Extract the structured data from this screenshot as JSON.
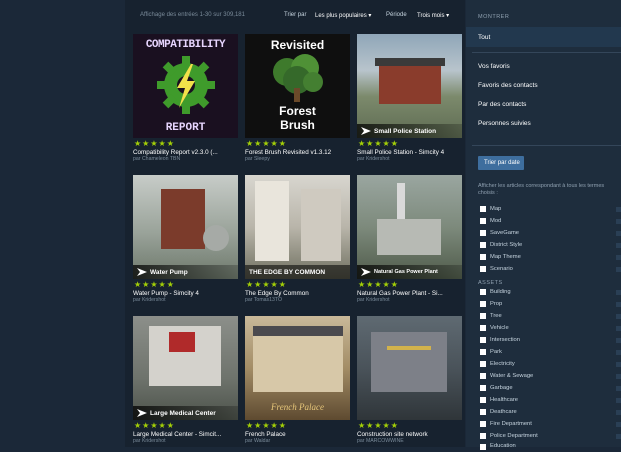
{
  "toolbar": {
    "count_text": "Affichage des entrées 1-30 sur 309,181",
    "sort_label": "Trier par",
    "sort_value": "Les plus populaires ▾",
    "period_label": "Période",
    "period_value": "Trois mois ▾"
  },
  "items": [
    {
      "title": "Compatibility Report v2.3.0 (...",
      "author": "par Chameleon TBN",
      "stars": "★★★★★",
      "thumb_text_top": "COMPATIBILITY",
      "thumb_text_bottom": "REPORT"
    },
    {
      "title": "Forest Brush Revisited v1.3.12",
      "author": "par Sleepy",
      "stars": "★★★★★",
      "thumb_text_top": "Revisited",
      "thumb_text_mid": "Forest",
      "thumb_text_bottom": "Brush"
    },
    {
      "title": "Small Police Station - Simcity 4",
      "author": "par Kridershot",
      "stars": "★★★★★",
      "badge": "Small Police Station"
    },
    {
      "title": "Water Pump - Simcity 4",
      "author": "par Kridershot",
      "stars": "★★★★★",
      "badge": "Water Pump"
    },
    {
      "title": "The Edge By Common",
      "author": "par Tomas13TO",
      "stars": "★★★★★",
      "badge": "THE EDGE BY COMMON"
    },
    {
      "title": "Natural Gas Power Plant - Si...",
      "author": "par Kridershot",
      "stars": "★★★★★",
      "badge": "Natural Gas Power Plant"
    },
    {
      "title": "Large Medical Center - Simcit...",
      "author": "par Kridershot",
      "stars": "★★★★★",
      "badge": "Large Medical Center"
    },
    {
      "title": "French Palace",
      "author": "par Waldar",
      "stars": "★★★★★",
      "badge": "French Palace"
    },
    {
      "title": "Construction site network",
      "author": "par MARCOWWINE",
      "stars": "★★★★★"
    }
  ],
  "sidebar": {
    "show_header": "MONTRER",
    "nav": [
      "Tout",
      "Vos favoris",
      "Favoris des contacts",
      "Par des contacts",
      "Personnes suivies"
    ],
    "sort_button": "Trier par date",
    "hint": "Afficher les articles correspondant à tous les termes choisis :",
    "tags_main": [
      "Map",
      "Mod",
      "SaveGame",
      "District Style",
      "Map Theme",
      "Scenario"
    ],
    "assets_header": "ASSETS",
    "tags_assets": [
      "Building",
      "Prop",
      "Tree",
      "Vehicle",
      "Intersection",
      "Park",
      "Electricity",
      "Water & Sewage",
      "Garbage",
      "Healthcare",
      "Deathcare",
      "Fire Department",
      "Police Department",
      "Education"
    ]
  },
  "colors": {
    "accent": "#a4d007",
    "button": "#3e6e9e",
    "selected_nav": "#22384e"
  }
}
